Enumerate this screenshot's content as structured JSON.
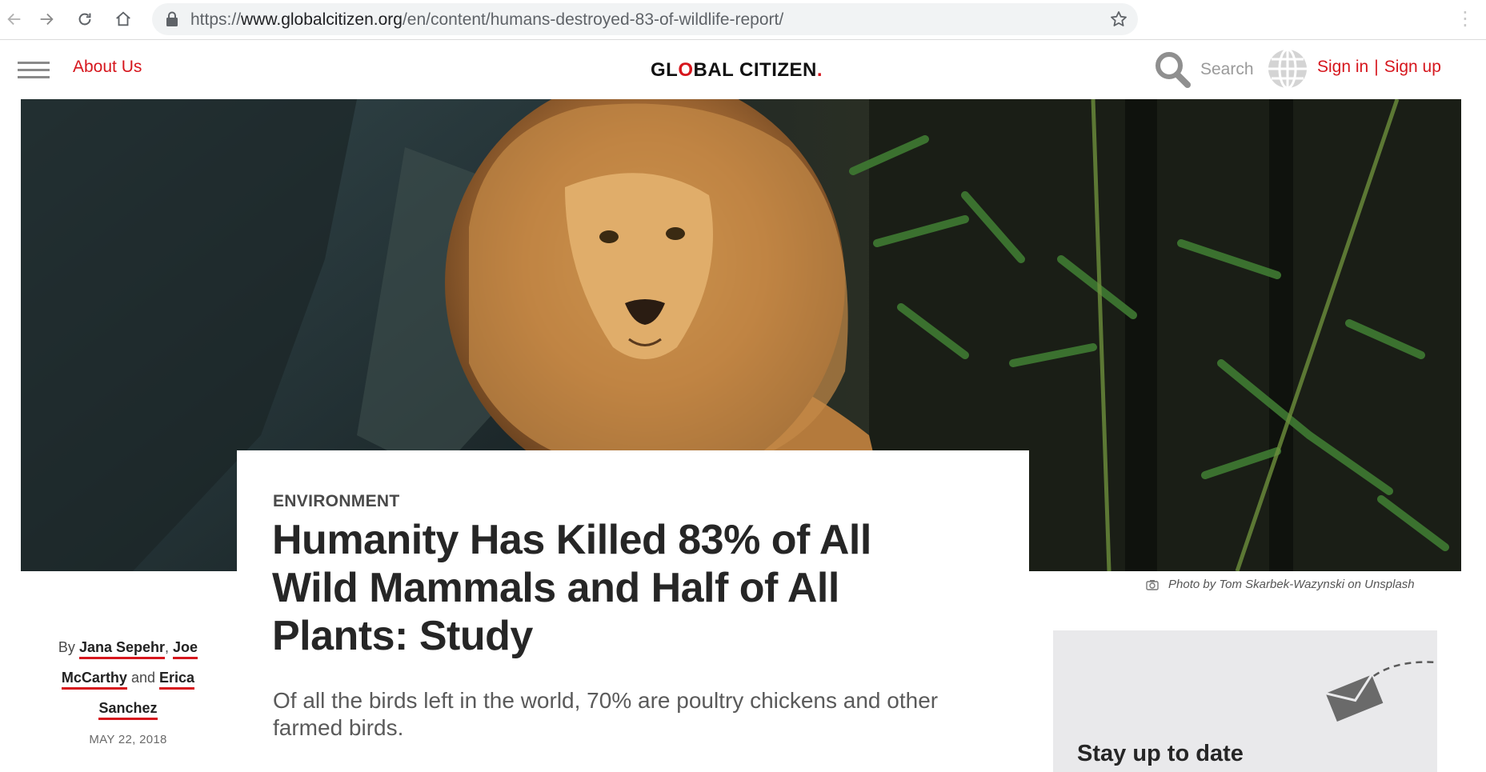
{
  "browser": {
    "url_prefix": "https://",
    "url_host": "www.globalcitizen.org",
    "url_path": "/en/content/humans-destroyed-83-of-wildlife-report/",
    "icons": [
      "back-arrow-icon",
      "forward-arrow-icon",
      "reload-icon",
      "home-icon",
      "lock-icon",
      "star-icon"
    ]
  },
  "header": {
    "about_label": "About Us",
    "logo_text_a": "GL",
    "logo_text_o": "O",
    "logo_text_b": "BAL CITIZEN",
    "logo_dot": ".",
    "search_label": "Search",
    "sign_in_label": "Sign in",
    "separator": "|",
    "sign_up_label": "Sign up"
  },
  "hero": {
    "photo_credit": "Photo by Tom Skarbek-Wazynski on Unsplash"
  },
  "article": {
    "category": "ENVIRONMENT",
    "headline": "Humanity Has Killed 83% of All Wild Mammals and Half of All Plants: Study",
    "dek": "Of all the birds left in the world, 70% are poultry chickens and other farmed birds.",
    "byline_prefix": "By",
    "authors": [
      "Jana Sepehr",
      "Joe McCarthy",
      "Erica Sanchez"
    ],
    "comma": ",",
    "and_word": "and",
    "date": "MAY 22, 2018"
  },
  "newsletter": {
    "title": "Stay up to date"
  },
  "colors": {
    "accent_red": "#d6161d",
    "text_dark": "#262626",
    "panel_gray": "#e9e9eb"
  }
}
